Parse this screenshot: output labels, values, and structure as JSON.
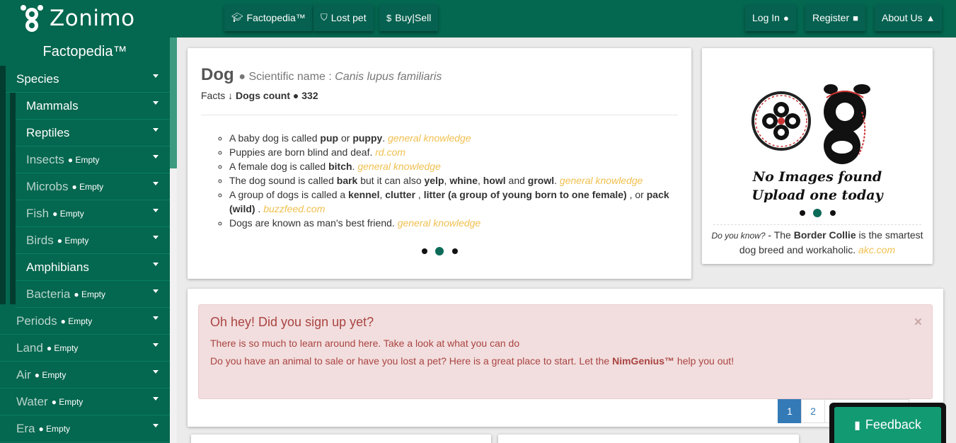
{
  "brand": {
    "name": "Zonimo"
  },
  "nav": {
    "factopedia": "Factopedia™",
    "lost_pet": "Lost pet",
    "buy_sell": "Buy|Sell",
    "login": "Log In",
    "register": "Register",
    "about": "About Us"
  },
  "sidebar": {
    "title": "Factopedia™",
    "empty_tag": "● Empty",
    "items": [
      {
        "label": "Species"
      },
      {
        "label": "Mammals"
      },
      {
        "label": "Reptiles"
      },
      {
        "label": "Insects"
      },
      {
        "label": "Microbs"
      },
      {
        "label": "Fish"
      },
      {
        "label": "Birds"
      },
      {
        "label": "Amphibians"
      },
      {
        "label": "Bacteria"
      },
      {
        "label": "Periods"
      },
      {
        "label": "Land"
      },
      {
        "label": "Air"
      },
      {
        "label": "Water"
      },
      {
        "label": "Era"
      }
    ]
  },
  "dog": {
    "name": "Dog",
    "sci_prefix": "● Scientific name : ",
    "sci_name": "Canis lupus familiaris",
    "facts_label": "Facts ↓ ",
    "count_label": "Dogs count ● 332",
    "facts": [
      {
        "a": "A baby dog is called ",
        "b1": "pup",
        "c": " or ",
        "b2": "puppy",
        "d": ". ",
        "src": "general knowledge"
      },
      {
        "a": "Puppies are born blind and deaf. ",
        "src": "rd.com"
      },
      {
        "a": "A female dog is called ",
        "b1": "bitch",
        "d": ". ",
        "src": "general knowledge"
      },
      {
        "a": "The dog sound is called ",
        "b1": "bark",
        "c": " but it can also ",
        "b2": "yelp",
        "e": ", ",
        "b3": "whine",
        "f": ", ",
        "b4": "howl",
        "g": " and ",
        "b5": "growl",
        "d": ". ",
        "src": "general knowledge"
      },
      {
        "a": "A group of dogs is called a ",
        "b1": "kennel",
        "c": ", ",
        "b2": "clutter",
        "e": " , ",
        "b3": "litter (a group of young born to one female)",
        "f": " , or ",
        "b4": "pack (wild)",
        "d": " . ",
        "src": "buzzfeed.com"
      },
      {
        "a": "Dogs are known as man's best friend. ",
        "src": "general knowledge"
      }
    ]
  },
  "noimage": {
    "line1": "No Images found",
    "line2": "Upload one today",
    "dyk_prefix": "Do you know?",
    "dyk_mid": " - The ",
    "dyk_bold": "Border Collie",
    "dyk_rest": " is the smartest dog breed and workaholic. ",
    "dyk_src": "akc.com"
  },
  "alert": {
    "heading": "Oh hey! Did you sign up yet?",
    "line1": "There is so much to learn around here. Take a look at what you can do",
    "line2_pre": "Do you have an animal to sale or have you lost a pet? Here is a great place to start. Let the ",
    "line2_bold": "NimGenius™",
    "line2_post": " help you out!",
    "close": "×"
  },
  "pagination": [
    "1",
    "2"
  ],
  "feedback": {
    "label": "Feedback"
  },
  "colors": {
    "brand": "#04674f",
    "alert_bg": "#f2dede",
    "source": "#f0c050",
    "active_page": "#337ab7"
  }
}
